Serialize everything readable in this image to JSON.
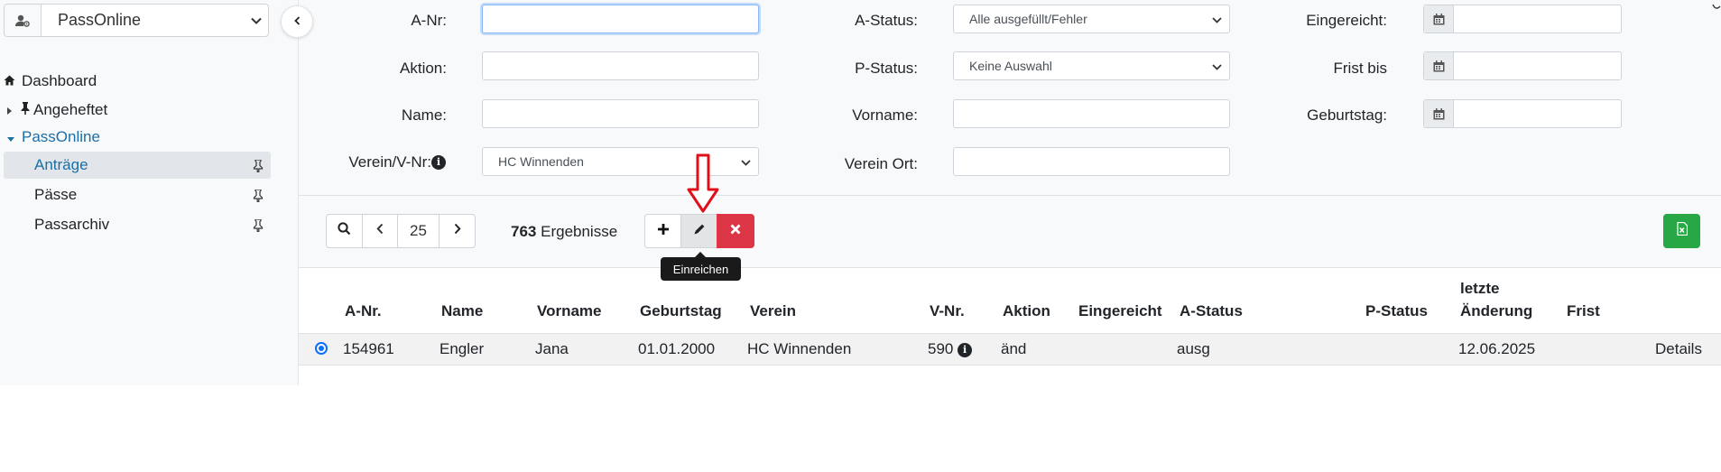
{
  "sidebar": {
    "app_select": "PassOnline",
    "items": [
      {
        "label": "Dashboard"
      },
      {
        "label": "Angeheftet"
      },
      {
        "label": "PassOnline"
      },
      {
        "label": "Anträge"
      },
      {
        "label": "Pässe"
      },
      {
        "label": "Passarchiv"
      }
    ]
  },
  "filters": {
    "a_nr": {
      "label": "A-Nr:",
      "value": ""
    },
    "aktion": {
      "label": "Aktion:",
      "value": ""
    },
    "name": {
      "label": "Name:",
      "value": ""
    },
    "verein": {
      "label": "Verein/V-Nr:",
      "value": "HC Winnenden"
    },
    "a_status": {
      "label": "A-Status:",
      "value": "Alle ausgefüllt/Fehler"
    },
    "p_status": {
      "label": "P-Status:",
      "value": "Keine Auswahl"
    },
    "vorname": {
      "label": "Vorname:",
      "value": ""
    },
    "verein_ort": {
      "label": "Verein Ort:",
      "value": ""
    },
    "eingereicht": {
      "label": "Eingereicht:",
      "value": ""
    },
    "frist_bis": {
      "label": "Frist bis",
      "value": ""
    },
    "geburtstag": {
      "label": "Geburtstag:",
      "value": ""
    }
  },
  "toolbar": {
    "page_size": "25",
    "results_count": "763",
    "results_label": "Ergebnisse",
    "tooltip": "Einreichen"
  },
  "table": {
    "headers": [
      "A-Nr.",
      "Name",
      "Vorname",
      "Geburtstag",
      "Verein",
      "V-Nr.",
      "Aktion",
      "Eingereicht",
      "A-Status",
      "P-Status",
      "letzte",
      "Änderung",
      "Frist"
    ],
    "rows": [
      {
        "a_nr": "154961",
        "name": "Engler",
        "vorname": "Jana",
        "geburtstag": "01.01.2000",
        "verein": "HC Winnenden",
        "v_nr": "590",
        "aktion": "änd",
        "eingereicht": "",
        "a_status": "ausg",
        "p_status": "",
        "letzte_aenderung": "12.06.2025",
        "frist": "",
        "details": "Details"
      }
    ]
  },
  "colors": {
    "link": "#1c6ea4",
    "delete": "#dc3545",
    "export": "#28a745",
    "annotation_arrow": "#e0101a"
  }
}
